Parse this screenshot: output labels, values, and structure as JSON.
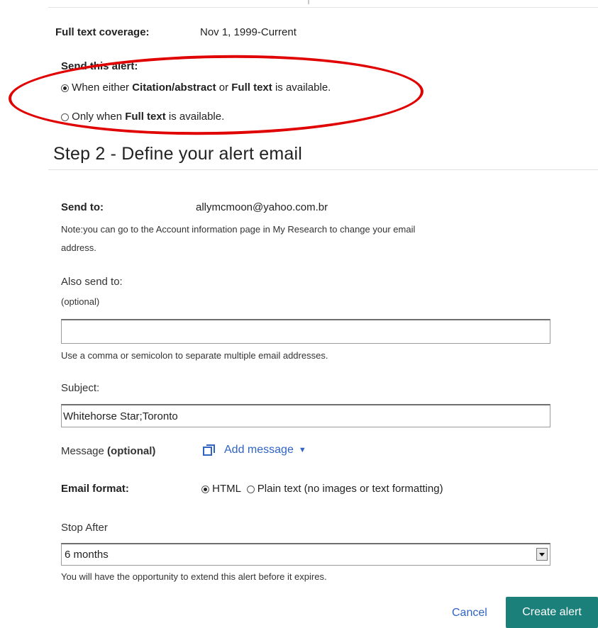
{
  "alert_options": {
    "coverage_label": "Full text coverage:",
    "coverage_value": "Nov 1, 1999-Current",
    "send_alert_label": "Send this alert:",
    "option1": {
      "prefix": "When either ",
      "b1": "Citation/abstract",
      "mid": " or ",
      "b2": "Full text",
      "suffix": " is available.",
      "selected": true
    },
    "option2": {
      "prefix": "Only when ",
      "b1": "Full text",
      "suffix": " is available.",
      "selected": false
    }
  },
  "step2": {
    "title": "Step 2 - Define your alert email",
    "send_to_label": "Send to:",
    "send_to_value": "allymcmoon@yahoo.com.br",
    "note_line1": "Note:you can go to the Account information page in My Research to change your email",
    "note_line2": "address.",
    "also_send_label": "Also send to:",
    "also_send_optional": "(optional)",
    "also_send_value": "",
    "also_send_hint": "Use a comma or semicolon to separate multiple email addresses.",
    "subject_label": "Subject:",
    "subject_value": "Whitehorse Star;Toronto",
    "message_label": "Message ",
    "message_optional": "(optional)",
    "add_message_link": "Add message",
    "add_message_caret": "▼",
    "email_format_label": "Email format:",
    "format_html": "HTML",
    "format_plain": "Plain text (no images or text formatting)",
    "format_selected": "HTML",
    "stop_after_label": "Stop After",
    "stop_after_value": "6 months",
    "stop_after_hint": "You will have the opportunity to extend this alert before it expires."
  },
  "actions": {
    "cancel": "Cancel",
    "create": "Create alert"
  },
  "colors": {
    "annotation_ellipse": "#e00000",
    "link": "#2f63c4",
    "primary_button": "#1b7f7a"
  }
}
